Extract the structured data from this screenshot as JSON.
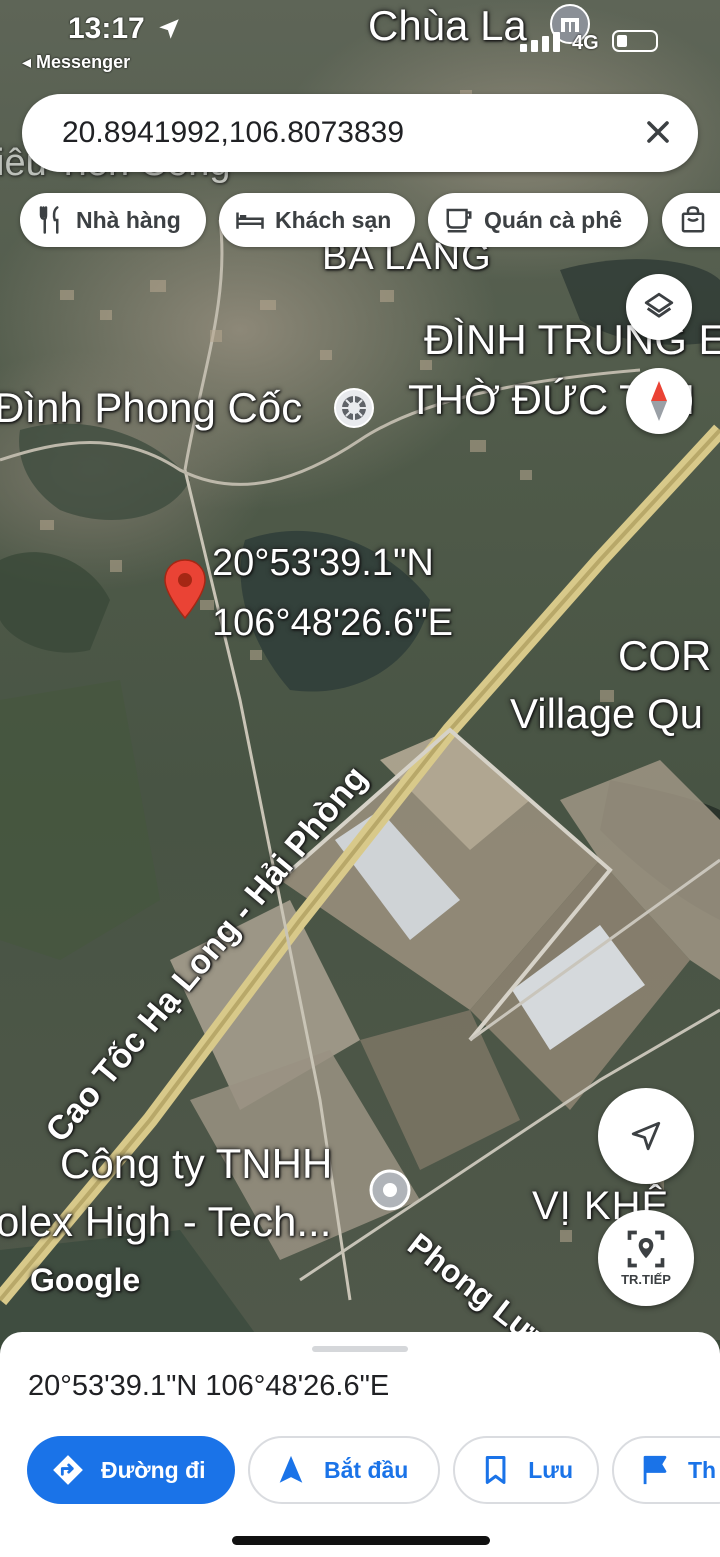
{
  "status_bar": {
    "time": "13:17",
    "back_app": "◂ Messenger",
    "network": "4G"
  },
  "search": {
    "query": "20.8941992,106.8073839"
  },
  "chips": [
    {
      "label": "Nhà hàng",
      "icon": "restaurant-icon"
    },
    {
      "label": "Khách sạn",
      "icon": "hotel-icon"
    },
    {
      "label": "Quán cà phê",
      "icon": "coffee-icon"
    }
  ],
  "map_labels": {
    "chua_la": "Chùa La",
    "ba_lang": "BA LANG",
    "dinh_trung": "ĐÌNH TRUNG E",
    "tho_duc": "THỜ ĐỨC T   ÁI",
    "dinh_phong_coc": "Đình Phong Cốc",
    "top_partial": "iêu Tiên Công",
    "pin_lat": "20°53'39.1\"N",
    "pin_lon": "106°48'26.6\"E",
    "cor": "COR",
    "village": "Village Qu",
    "highway": "Cao Tốc Hạ Long - Hải Phòng",
    "company_line1": "Công ty TNHH",
    "company_line2": "olex High - Tech...",
    "vi_khe": "VỊ KHÊ",
    "phong_luu": "Phong Lưu",
    "google": "Google"
  },
  "map_buttons": {
    "navigate_label": "TR.TIẾP"
  },
  "sheet": {
    "coordinates": "20°53'39.1\"N 106°48'26.6\"E",
    "actions": [
      {
        "label": "Đường đi",
        "icon": "directions-icon"
      },
      {
        "label": "Bắt đầu",
        "icon": "navigation-arrow-icon"
      },
      {
        "label": "Lưu",
        "icon": "bookmark-icon"
      },
      {
        "label": "Th",
        "icon": "flag-icon"
      }
    ]
  },
  "colors": {
    "accent": "#1a73e8",
    "pin": "#ea4335",
    "highway": "#c9b878"
  }
}
